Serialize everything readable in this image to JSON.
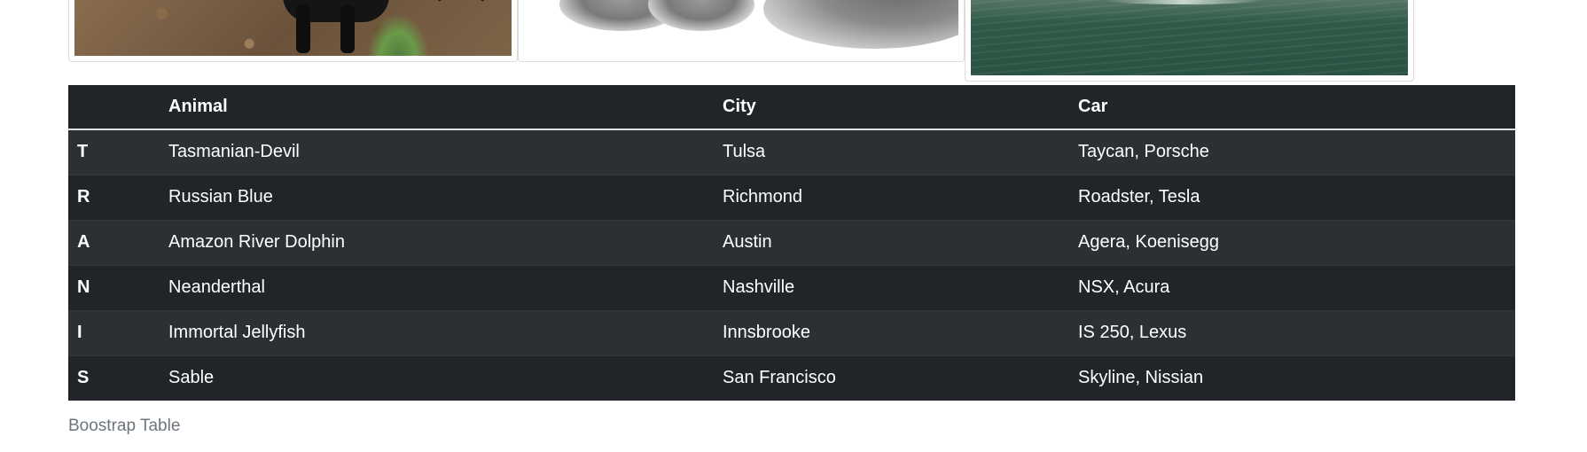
{
  "images": [
    {
      "alt": "dog"
    },
    {
      "alt": "cat"
    },
    {
      "alt": "water"
    }
  ],
  "table": {
    "headers": [
      "",
      "Animal",
      "City",
      "Car"
    ],
    "rows": [
      {
        "letter": "T",
        "animal": "Tasmanian-Devil",
        "city": "Tulsa",
        "car": "Taycan, Porsche"
      },
      {
        "letter": "R",
        "animal": "Russian Blue",
        "city": "Richmond",
        "car": "Roadster, Tesla"
      },
      {
        "letter": "A",
        "animal": "Amazon River Dolphin",
        "city": "Austin",
        "car": "Agera, Koenisegg"
      },
      {
        "letter": "N",
        "animal": "Neanderthal",
        "city": "Nashville",
        "car": "NSX, Acura"
      },
      {
        "letter": "I",
        "animal": "Immortal Jellyfish",
        "city": "Innsbrooke",
        "car": "IS 250, Lexus"
      },
      {
        "letter": "S",
        "animal": "Sable",
        "city": "San Francisco",
        "car": "Skyline, Nissian"
      }
    ]
  },
  "caption": "Boostrap Table",
  "colors": {
    "table_bg": "#212529",
    "table_stripe": "#2c3034",
    "caption": "#6c757d"
  }
}
